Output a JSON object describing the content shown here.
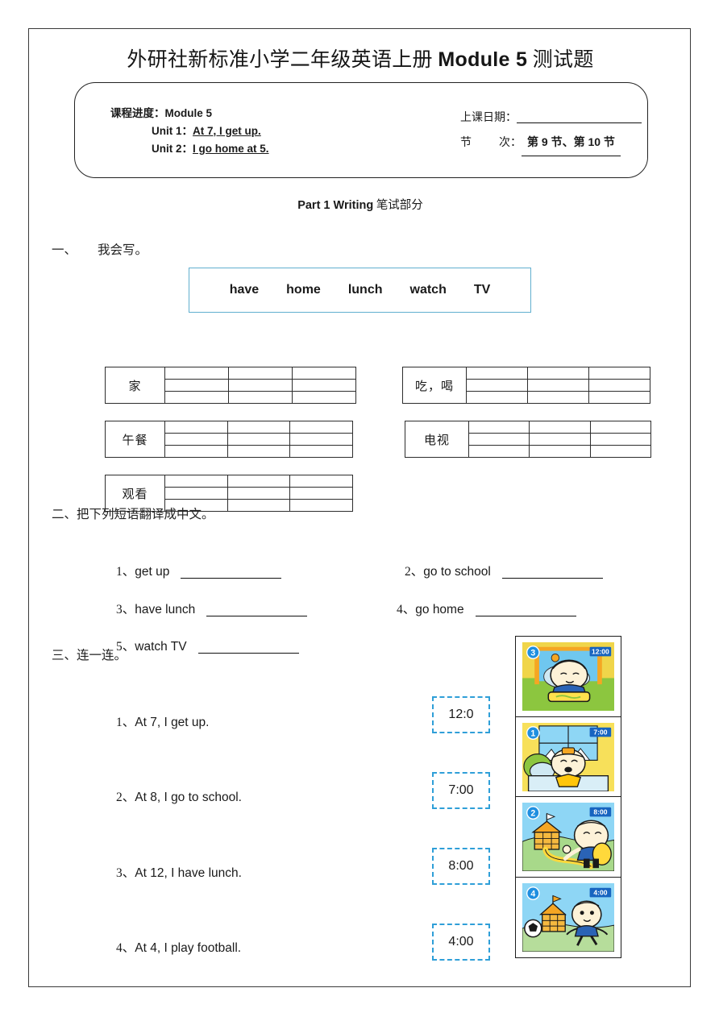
{
  "document": {
    "title_cn_prefix": "外研社新标准小学二年级英语上册 ",
    "title_latin": "Module 5",
    "title_cn_suffix": " 测试题"
  },
  "info_box": {
    "progress_label": "课程进度：",
    "progress_value": "Module 5",
    "unit1_label": "Unit 1：",
    "unit1_value": "At 7, I get up.",
    "unit2_label": "Unit 2：",
    "unit2_value": "I go home at 5.",
    "date_label": "上课日期：",
    "date_value": "",
    "period_label_a": "节",
    "period_label_b": "次：",
    "period_value": "第 9 节、第 10 节"
  },
  "part_heading": {
    "bold": "Part 1 Writing",
    "cn": " 笔试部分"
  },
  "sections": {
    "one": {
      "num": "一、",
      "title": "我会写。"
    },
    "two": {
      "num": "二、",
      "title": "把下列短语翻译成中文。"
    },
    "three": {
      "num": "三、",
      "title": "连一连。"
    }
  },
  "word_bank": {
    "words": [
      "have",
      "home",
      "lunch",
      "watch",
      "TV"
    ],
    "border_color": "#61afcf"
  },
  "writing_tables": [
    {
      "label": "家"
    },
    {
      "label": "吃，喝"
    },
    {
      "label": "午餐"
    },
    {
      "label": "电视"
    },
    {
      "label": "观看"
    }
  ],
  "translate_items": [
    {
      "num": "1、",
      "phrase": "get up"
    },
    {
      "num": "2、",
      "phrase": "go to school"
    },
    {
      "num": "3、",
      "phrase": "have lunch"
    },
    {
      "num": "4、",
      "phrase": "go home"
    },
    {
      "num": "5、",
      "phrase": "watch TV"
    }
  ],
  "match": {
    "sentences": [
      {
        "num": "1、",
        "text": "At 7, I get up."
      },
      {
        "num": "2、",
        "text": "At 8, I go to school."
      },
      {
        "num": "3、",
        "text": "At 12, I have lunch."
      },
      {
        "num": "4、",
        "text": "At 4, I play football."
      }
    ],
    "time_boxes": [
      "12:0",
      "7:00",
      "8:00",
      "4:00"
    ],
    "time_box_border_color": "#2f9fd8",
    "pictures": [
      {
        "badge": "3",
        "clock": "12:00",
        "scene": "boy-eating-lunch-at-table"
      },
      {
        "badge": "1",
        "clock": "7:00",
        "scene": "boy-getting-up-in-bed"
      },
      {
        "badge": "2",
        "clock": "8:00",
        "scene": "boy-walking-to-school"
      },
      {
        "badge": "4",
        "clock": "4:00",
        "scene": "boy-playing-football"
      }
    ]
  }
}
